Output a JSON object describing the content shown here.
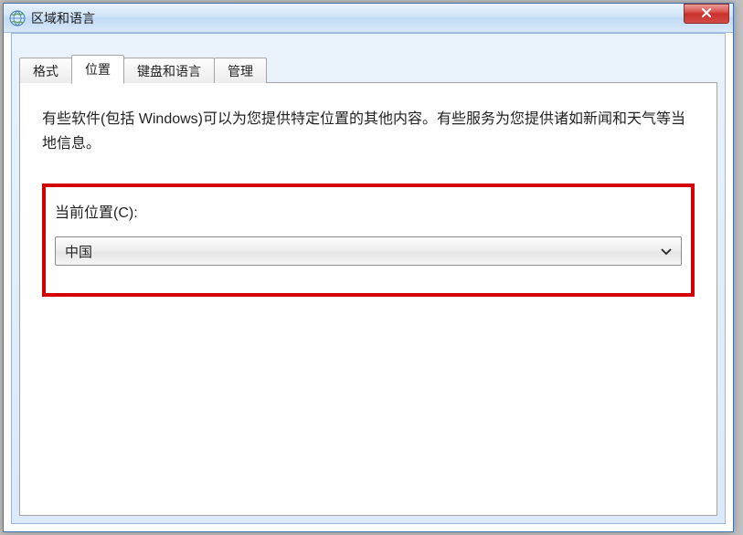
{
  "window": {
    "title": "区域和语言"
  },
  "tabs": [
    {
      "label": "格式"
    },
    {
      "label": "位置"
    },
    {
      "label": "键盘和语言"
    },
    {
      "label": "管理"
    }
  ],
  "location_tab": {
    "description": "有些软件(包括 Windows)可以为您提供特定位置的其他内容。有些服务为您提供诸如新闻和天气等当地信息。",
    "field_label": "当前位置(C):",
    "selected_value": "中国"
  }
}
